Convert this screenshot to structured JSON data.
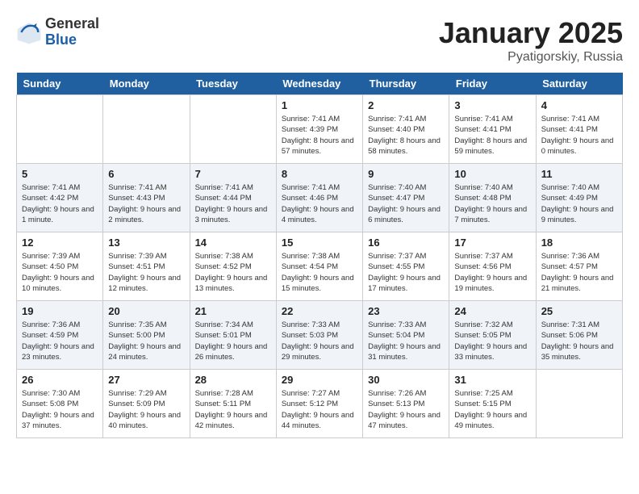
{
  "logo": {
    "general": "General",
    "blue": "Blue"
  },
  "title": "January 2025",
  "subtitle": "Pyatigorskiy, Russia",
  "days_header": [
    "Sunday",
    "Monday",
    "Tuesday",
    "Wednesday",
    "Thursday",
    "Friday",
    "Saturday"
  ],
  "weeks": [
    [
      {
        "day": "",
        "content": ""
      },
      {
        "day": "",
        "content": ""
      },
      {
        "day": "",
        "content": ""
      },
      {
        "day": "1",
        "content": "Sunrise: 7:41 AM\nSunset: 4:39 PM\nDaylight: 8 hours and 57 minutes."
      },
      {
        "day": "2",
        "content": "Sunrise: 7:41 AM\nSunset: 4:40 PM\nDaylight: 8 hours and 58 minutes."
      },
      {
        "day": "3",
        "content": "Sunrise: 7:41 AM\nSunset: 4:41 PM\nDaylight: 8 hours and 59 minutes."
      },
      {
        "day": "4",
        "content": "Sunrise: 7:41 AM\nSunset: 4:41 PM\nDaylight: 9 hours and 0 minutes."
      }
    ],
    [
      {
        "day": "5",
        "content": "Sunrise: 7:41 AM\nSunset: 4:42 PM\nDaylight: 9 hours and 1 minute."
      },
      {
        "day": "6",
        "content": "Sunrise: 7:41 AM\nSunset: 4:43 PM\nDaylight: 9 hours and 2 minutes."
      },
      {
        "day": "7",
        "content": "Sunrise: 7:41 AM\nSunset: 4:44 PM\nDaylight: 9 hours and 3 minutes."
      },
      {
        "day": "8",
        "content": "Sunrise: 7:41 AM\nSunset: 4:46 PM\nDaylight: 9 hours and 4 minutes."
      },
      {
        "day": "9",
        "content": "Sunrise: 7:40 AM\nSunset: 4:47 PM\nDaylight: 9 hours and 6 minutes."
      },
      {
        "day": "10",
        "content": "Sunrise: 7:40 AM\nSunset: 4:48 PM\nDaylight: 9 hours and 7 minutes."
      },
      {
        "day": "11",
        "content": "Sunrise: 7:40 AM\nSunset: 4:49 PM\nDaylight: 9 hours and 9 minutes."
      }
    ],
    [
      {
        "day": "12",
        "content": "Sunrise: 7:39 AM\nSunset: 4:50 PM\nDaylight: 9 hours and 10 minutes."
      },
      {
        "day": "13",
        "content": "Sunrise: 7:39 AM\nSunset: 4:51 PM\nDaylight: 9 hours and 12 minutes."
      },
      {
        "day": "14",
        "content": "Sunrise: 7:38 AM\nSunset: 4:52 PM\nDaylight: 9 hours and 13 minutes."
      },
      {
        "day": "15",
        "content": "Sunrise: 7:38 AM\nSunset: 4:54 PM\nDaylight: 9 hours and 15 minutes."
      },
      {
        "day": "16",
        "content": "Sunrise: 7:37 AM\nSunset: 4:55 PM\nDaylight: 9 hours and 17 minutes."
      },
      {
        "day": "17",
        "content": "Sunrise: 7:37 AM\nSunset: 4:56 PM\nDaylight: 9 hours and 19 minutes."
      },
      {
        "day": "18",
        "content": "Sunrise: 7:36 AM\nSunset: 4:57 PM\nDaylight: 9 hours and 21 minutes."
      }
    ],
    [
      {
        "day": "19",
        "content": "Sunrise: 7:36 AM\nSunset: 4:59 PM\nDaylight: 9 hours and 23 minutes."
      },
      {
        "day": "20",
        "content": "Sunrise: 7:35 AM\nSunset: 5:00 PM\nDaylight: 9 hours and 24 minutes."
      },
      {
        "day": "21",
        "content": "Sunrise: 7:34 AM\nSunset: 5:01 PM\nDaylight: 9 hours and 26 minutes."
      },
      {
        "day": "22",
        "content": "Sunrise: 7:33 AM\nSunset: 5:03 PM\nDaylight: 9 hours and 29 minutes."
      },
      {
        "day": "23",
        "content": "Sunrise: 7:33 AM\nSunset: 5:04 PM\nDaylight: 9 hours and 31 minutes."
      },
      {
        "day": "24",
        "content": "Sunrise: 7:32 AM\nSunset: 5:05 PM\nDaylight: 9 hours and 33 minutes."
      },
      {
        "day": "25",
        "content": "Sunrise: 7:31 AM\nSunset: 5:06 PM\nDaylight: 9 hours and 35 minutes."
      }
    ],
    [
      {
        "day": "26",
        "content": "Sunrise: 7:30 AM\nSunset: 5:08 PM\nDaylight: 9 hours and 37 minutes."
      },
      {
        "day": "27",
        "content": "Sunrise: 7:29 AM\nSunset: 5:09 PM\nDaylight: 9 hours and 40 minutes."
      },
      {
        "day": "28",
        "content": "Sunrise: 7:28 AM\nSunset: 5:11 PM\nDaylight: 9 hours and 42 minutes."
      },
      {
        "day": "29",
        "content": "Sunrise: 7:27 AM\nSunset: 5:12 PM\nDaylight: 9 hours and 44 minutes."
      },
      {
        "day": "30",
        "content": "Sunrise: 7:26 AM\nSunset: 5:13 PM\nDaylight: 9 hours and 47 minutes."
      },
      {
        "day": "31",
        "content": "Sunrise: 7:25 AM\nSunset: 5:15 PM\nDaylight: 9 hours and 49 minutes."
      },
      {
        "day": "",
        "content": ""
      }
    ]
  ]
}
